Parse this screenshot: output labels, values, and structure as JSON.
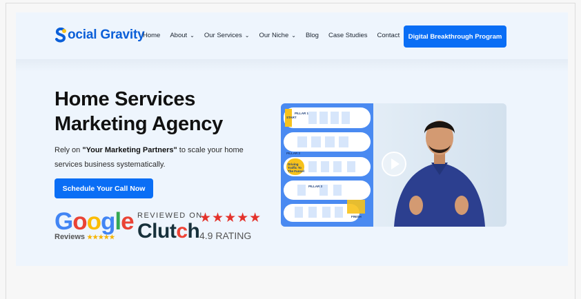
{
  "brand": {
    "logo_text": "ocial Gravity",
    "color": "#0b5fd8"
  },
  "nav": {
    "items": [
      {
        "label": "Home",
        "has_dropdown": false
      },
      {
        "label": "About",
        "has_dropdown": true
      },
      {
        "label": "Our Services",
        "has_dropdown": true
      },
      {
        "label": "Our Niche",
        "has_dropdown": true
      },
      {
        "label": "Blog",
        "has_dropdown": false
      },
      {
        "label": "Case Studies",
        "has_dropdown": false
      },
      {
        "label": "Contact",
        "has_dropdown": false
      }
    ],
    "cta_label": "Digital Breakthrough Program"
  },
  "hero": {
    "title_line1": "Home Services",
    "title_line2": "Marketing Agency",
    "subtitle_prefix": "Rely on ",
    "subtitle_bold": "\"Your Marketing Partners\"",
    "subtitle_suffix": " to scale your home services business systematically.",
    "cta_label": "Schedule Your Call Now"
  },
  "badges": {
    "google_word": "Google",
    "google_reviews": "Reviews",
    "google_stars": "★★★★★",
    "clutch_top": "REVIEWED ON",
    "clutch_word": "Clutch",
    "rating_stars": "★★★★★",
    "rating_text": "4.9 RATING"
  },
  "video": {
    "board_labels": [
      "START",
      "PILLAR 1",
      "PILLAR 2",
      "PILLAR 3",
      "Driving Traffic To The Funnel",
      "FINISH"
    ],
    "play_icon": "play-icon"
  },
  "colors": {
    "accent": "#0a6ef5",
    "page_bg": "#eef5fd",
    "rating_red": "#e4322b"
  }
}
